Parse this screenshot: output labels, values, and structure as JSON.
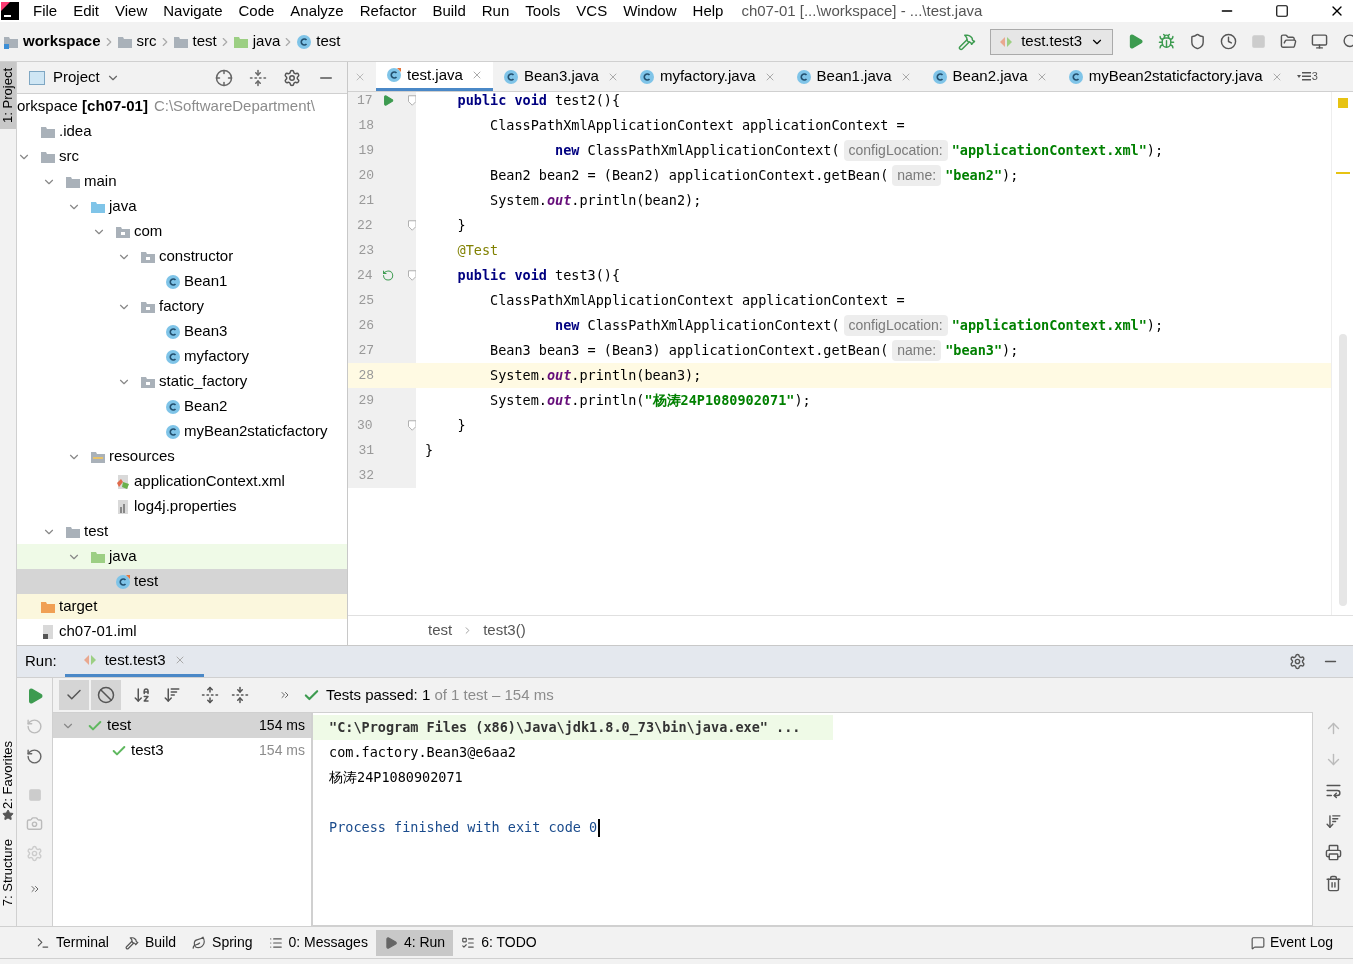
{
  "menu": [
    "File",
    "Edit",
    "View",
    "Navigate",
    "Code",
    "Analyze",
    "Refactor",
    "Build",
    "Run",
    "Tools",
    "VCS",
    "Window",
    "Help"
  ],
  "window": {
    "title": "ch07-01 [...\\workspace] - ...\\test.java"
  },
  "breadcrumb": [
    {
      "label": "workspace",
      "kind": "module"
    },
    {
      "label": "src",
      "kind": "folder"
    },
    {
      "label": "test",
      "kind": "folder"
    },
    {
      "label": "java",
      "kind": "test-source"
    },
    {
      "label": "test",
      "kind": "class"
    }
  ],
  "run_config": "test.test3",
  "side_strip": {
    "top": "1: Project",
    "favorites": "2: Favorites",
    "structure": "7: Structure"
  },
  "project": {
    "title": "Project",
    "root": {
      "label": "orkspace",
      "module": "[ch07-01]",
      "path": "C:\\SoftwareDepartment\\"
    },
    "tree": [
      {
        "label": ".idea",
        "kind": "folder",
        "selected": false
      },
      {
        "label": "src",
        "kind": "folder",
        "selected": false,
        "expanded": true,
        "children": [
          {
            "label": "main",
            "kind": "folder",
            "selected": false,
            "expanded": true,
            "children": [
              {
                "label": "java",
                "kind": "source",
                "selected": false,
                "expanded": true,
                "children": [
                  {
                    "label": "com",
                    "kind": "package",
                    "selected": false,
                    "expanded": true,
                    "children": [
                      {
                        "label": "constructor",
                        "kind": "package",
                        "selected": false,
                        "expanded": true,
                        "children": [
                          {
                            "label": "Bean1",
                            "kind": "class",
                            "selected": false
                          }
                        ]
                      },
                      {
                        "label": "factory",
                        "kind": "package",
                        "selected": false,
                        "expanded": true,
                        "children": [
                          {
                            "label": "Bean3",
                            "kind": "class",
                            "selected": false
                          },
                          {
                            "label": "myfactory",
                            "kind": "class",
                            "selected": false
                          }
                        ]
                      },
                      {
                        "label": "static_factory",
                        "kind": "package",
                        "selected": false,
                        "expanded": true,
                        "children": [
                          {
                            "label": "Bean2",
                            "kind": "class",
                            "selected": false
                          },
                          {
                            "label": "myBean2staticfactory",
                            "kind": "class",
                            "selected": false
                          }
                        ]
                      }
                    ]
                  }
                ]
              },
              {
                "label": "resources",
                "kind": "resources",
                "selected": false,
                "expanded": true,
                "children": [
                  {
                    "label": "applicationContext.xml",
                    "kind": "xml",
                    "selected": false
                  },
                  {
                    "label": "log4j.properties",
                    "kind": "properties",
                    "selected": false
                  }
                ]
              }
            ]
          },
          {
            "label": "test",
            "kind": "folder",
            "selected": false,
            "expanded": true,
            "children": [
              {
                "label": "java",
                "kind": "test-source",
                "selected": false,
                "expanded": true,
                "children": [
                  {
                    "label": "test",
                    "kind": "test-class",
                    "selected": true
                  }
                ]
              }
            ]
          }
        ]
      },
      {
        "label": "target",
        "kind": "excluded",
        "selected": false
      },
      {
        "label": "ch07-01.iml",
        "kind": "iml",
        "selected": false
      }
    ]
  },
  "editor_tabs": [
    {
      "label": "test.java",
      "kind": "test-class",
      "selected": true
    },
    {
      "label": "Bean3.java",
      "kind": "class",
      "selected": false
    },
    {
      "label": "myfactory.java",
      "kind": "class",
      "selected": false
    },
    {
      "label": "Bean1.java",
      "kind": "class",
      "selected": false
    },
    {
      "label": "Bean2.java",
      "kind": "class",
      "selected": false
    },
    {
      "label": "myBean2staticfactory.java",
      "kind": "class",
      "selected": false
    }
  ],
  "hidden_tab_count": "3",
  "code": [
    {
      "number": "17",
      "kind": "run",
      "fold": true,
      "current": false,
      "tokens": [
        {
          "kind": "keyword",
          "text": "    public void"
        },
        {
          "kind": "plain",
          "text": " test2(){"
        }
      ]
    },
    {
      "number": "18",
      "kind": "plain",
      "fold": false,
      "current": false,
      "tokens": [
        {
          "kind": "plain",
          "text": "        ClassPathXmlApplicationContext applicationContext ="
        }
      ]
    },
    {
      "number": "19",
      "kind": "plain",
      "fold": false,
      "current": false,
      "tokens": [
        {
          "kind": "keyword",
          "text": "                new"
        },
        {
          "kind": "plain",
          "text": " ClassPathXmlApplicationContext("
        },
        {
          "kind": "hint",
          "text": "configLocation:"
        },
        {
          "kind": "string",
          "text": "\"applicationContext.xml\""
        },
        {
          "kind": "plain",
          "text": ");"
        }
      ]
    },
    {
      "number": "20",
      "kind": "plain",
      "fold": false,
      "current": false,
      "tokens": [
        {
          "kind": "plain",
          "text": "        Bean2 bean2 = (Bean2) applicationContext.getBean("
        },
        {
          "kind": "hint",
          "text": "name:"
        },
        {
          "kind": "string",
          "text": "\"bean2\""
        },
        {
          "kind": "plain",
          "text": ");"
        }
      ]
    },
    {
      "number": "21",
      "kind": "plain",
      "fold": false,
      "current": false,
      "tokens": [
        {
          "kind": "plain",
          "text": "        System."
        },
        {
          "kind": "field",
          "text": "out"
        },
        {
          "kind": "plain",
          "text": ".println(bean2);"
        }
      ]
    },
    {
      "number": "22",
      "kind": "plain",
      "fold": true,
      "current": false,
      "tokens": [
        {
          "kind": "plain",
          "text": "    }"
        }
      ]
    },
    {
      "number": "23",
      "kind": "plain",
      "fold": false,
      "current": false,
      "tokens": [
        {
          "kind": "annotation",
          "text": "    @Test"
        }
      ]
    },
    {
      "number": "24",
      "kind": "rerun",
      "fold": true,
      "current": false,
      "tokens": [
        {
          "kind": "keyword",
          "text": "    public void"
        },
        {
          "kind": "plain",
          "text": " test3(){"
        }
      ]
    },
    {
      "number": "25",
      "kind": "plain",
      "fold": false,
      "current": false,
      "tokens": [
        {
          "kind": "plain",
          "text": "        ClassPathXmlApplicationContext applicationContext ="
        }
      ]
    },
    {
      "number": "26",
      "kind": "plain",
      "fold": false,
      "current": false,
      "tokens": [
        {
          "kind": "keyword",
          "text": "                new"
        },
        {
          "kind": "plain",
          "text": " ClassPathXmlApplicationContext("
        },
        {
          "kind": "hint",
          "text": "configLocation:"
        },
        {
          "kind": "string",
          "text": "\"applicationContext.xml\""
        },
        {
          "kind": "plain",
          "text": ");"
        }
      ]
    },
    {
      "number": "27",
      "kind": "plain",
      "fold": false,
      "current": false,
      "tokens": [
        {
          "kind": "plain",
          "text": "        Bean3 bean3 = (Bean3) applicationContext.getBean("
        },
        {
          "kind": "hint",
          "text": "name:"
        },
        {
          "kind": "string",
          "text": "\"bean3\""
        },
        {
          "kind": "plain",
          "text": ");"
        }
      ]
    },
    {
      "number": "28",
      "kind": "plain",
      "fold": false,
      "current": true,
      "tokens": [
        {
          "kind": "plain",
          "text": "        System."
        },
        {
          "kind": "field",
          "text": "out"
        },
        {
          "kind": "plain",
          "text": ".println(bean3);"
        }
      ]
    },
    {
      "number": "29",
      "kind": "plain",
      "fold": false,
      "current": false,
      "tokens": [
        {
          "kind": "plain",
          "text": "        System."
        },
        {
          "kind": "field",
          "text": "out"
        },
        {
          "kind": "plain",
          "text": ".println("
        },
        {
          "kind": "string",
          "text": "\"杨涛24P1080902071\""
        },
        {
          "kind": "plain",
          "text": ");"
        }
      ]
    },
    {
      "number": "30",
      "kind": "plain",
      "fold": true,
      "current": false,
      "tokens": [
        {
          "kind": "plain",
          "text": "    }"
        }
      ]
    },
    {
      "number": "31",
      "kind": "plain",
      "fold": false,
      "current": false,
      "tokens": [
        {
          "kind": "plain",
          "text": "}"
        }
      ]
    },
    {
      "number": "32",
      "kind": "plain",
      "fold": false,
      "current": false
    }
  ],
  "editor_breadcrumb": [
    "test",
    "test3()"
  ],
  "run": {
    "label": "Run:",
    "tab": "test.test3",
    "status": {
      "passed": "Tests passed: 1",
      "detail": "of 1 test – 154 ms"
    },
    "tests": [
      {
        "label": "test",
        "time": "154 ms",
        "selected": true,
        "expanded": true,
        "children": [
          {
            "label": "test3",
            "time": "154 ms",
            "selected": false
          }
        ]
      }
    ],
    "console": [
      {
        "kind": "command",
        "text": "\"C:\\Program Files (x86)\\Java\\jdk1.8.0_73\\bin\\java.exe\" ..."
      },
      {
        "kind": "output",
        "text": "com.factory.Bean3@e6aa2"
      },
      {
        "kind": "output",
        "text": "杨涛24P1080902071"
      },
      {
        "kind": "blank"
      },
      {
        "kind": "exit",
        "text": "Process finished with exit code 0"
      }
    ]
  },
  "bottom_tabs": [
    {
      "label": "Terminal",
      "kind": "terminal",
      "selected": false
    },
    {
      "label": "Build",
      "kind": "hammer",
      "selected": false
    },
    {
      "label": "Spring",
      "kind": "leaf",
      "selected": false
    },
    {
      "label": "0: Messages",
      "kind": "list",
      "selected": false
    },
    {
      "label": "4: Run",
      "kind": "play",
      "selected": true
    },
    {
      "label": "6: TODO",
      "kind": "todo",
      "selected": false
    }
  ],
  "event_log": "Event Log"
}
